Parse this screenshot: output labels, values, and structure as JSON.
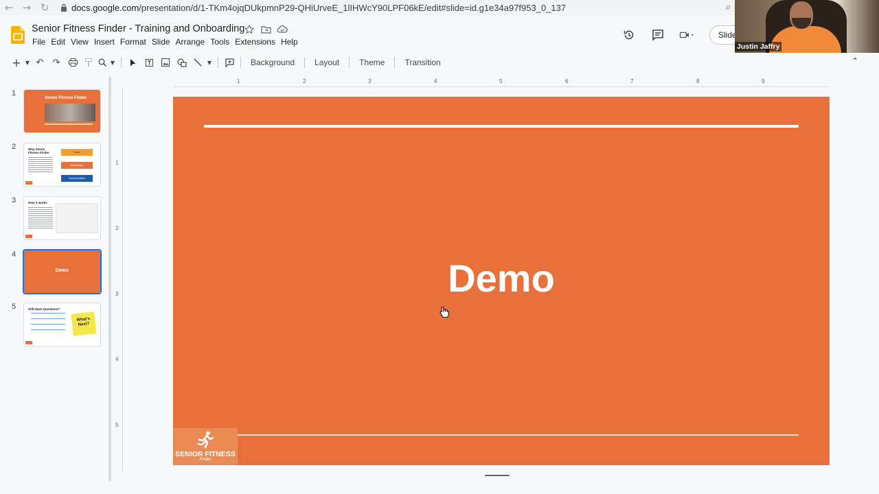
{
  "browser": {
    "url_host": "docs.google.com",
    "url_path": "/presentation/d/1-TKm4ojqDUkpmnP29-QHiUrveE_1lIHWcY90LPF06kE/edit#slide=id.g1e34a97f953_0_137"
  },
  "doc": {
    "title": "Senior Fitness Finder - Training and Onboarding"
  },
  "menu": [
    "File",
    "Edit",
    "View",
    "Insert",
    "Format",
    "Slide",
    "Arrange",
    "Tools",
    "Extensions",
    "Help"
  ],
  "header": {
    "slideshow_label": "Slide"
  },
  "webcam": {
    "name": "Justin Jaffry"
  },
  "toolbar": {
    "background": "Background",
    "layout": "Layout",
    "theme": "Theme",
    "transition": "Transition"
  },
  "ruler": {
    "horizontal": [
      "1",
      "2",
      "3",
      "4",
      "5",
      "6",
      "7",
      "8",
      "9"
    ],
    "vertical": [
      "1",
      "2",
      "3",
      "4",
      "5"
    ]
  },
  "slides": [
    {
      "number": "1",
      "title": "Senior Fitness Finder"
    },
    {
      "number": "2",
      "title": "Why Senior Fitness Finder",
      "boxes": [
        "Trainer",
        "Marketplace",
        "Communication"
      ]
    },
    {
      "number": "3",
      "title": "How it works"
    },
    {
      "number": "4",
      "title": "Demo",
      "selected": true
    },
    {
      "number": "5",
      "title": "Still Have Questions?",
      "note": "What's Next?"
    }
  ],
  "current_slide": {
    "title": "Demo",
    "logo_brand": "SENIOR FITNESS",
    "logo_sub": "Finder"
  },
  "colors": {
    "slide_orange": "#e8703a",
    "accent_blue": "#1a73e8"
  }
}
